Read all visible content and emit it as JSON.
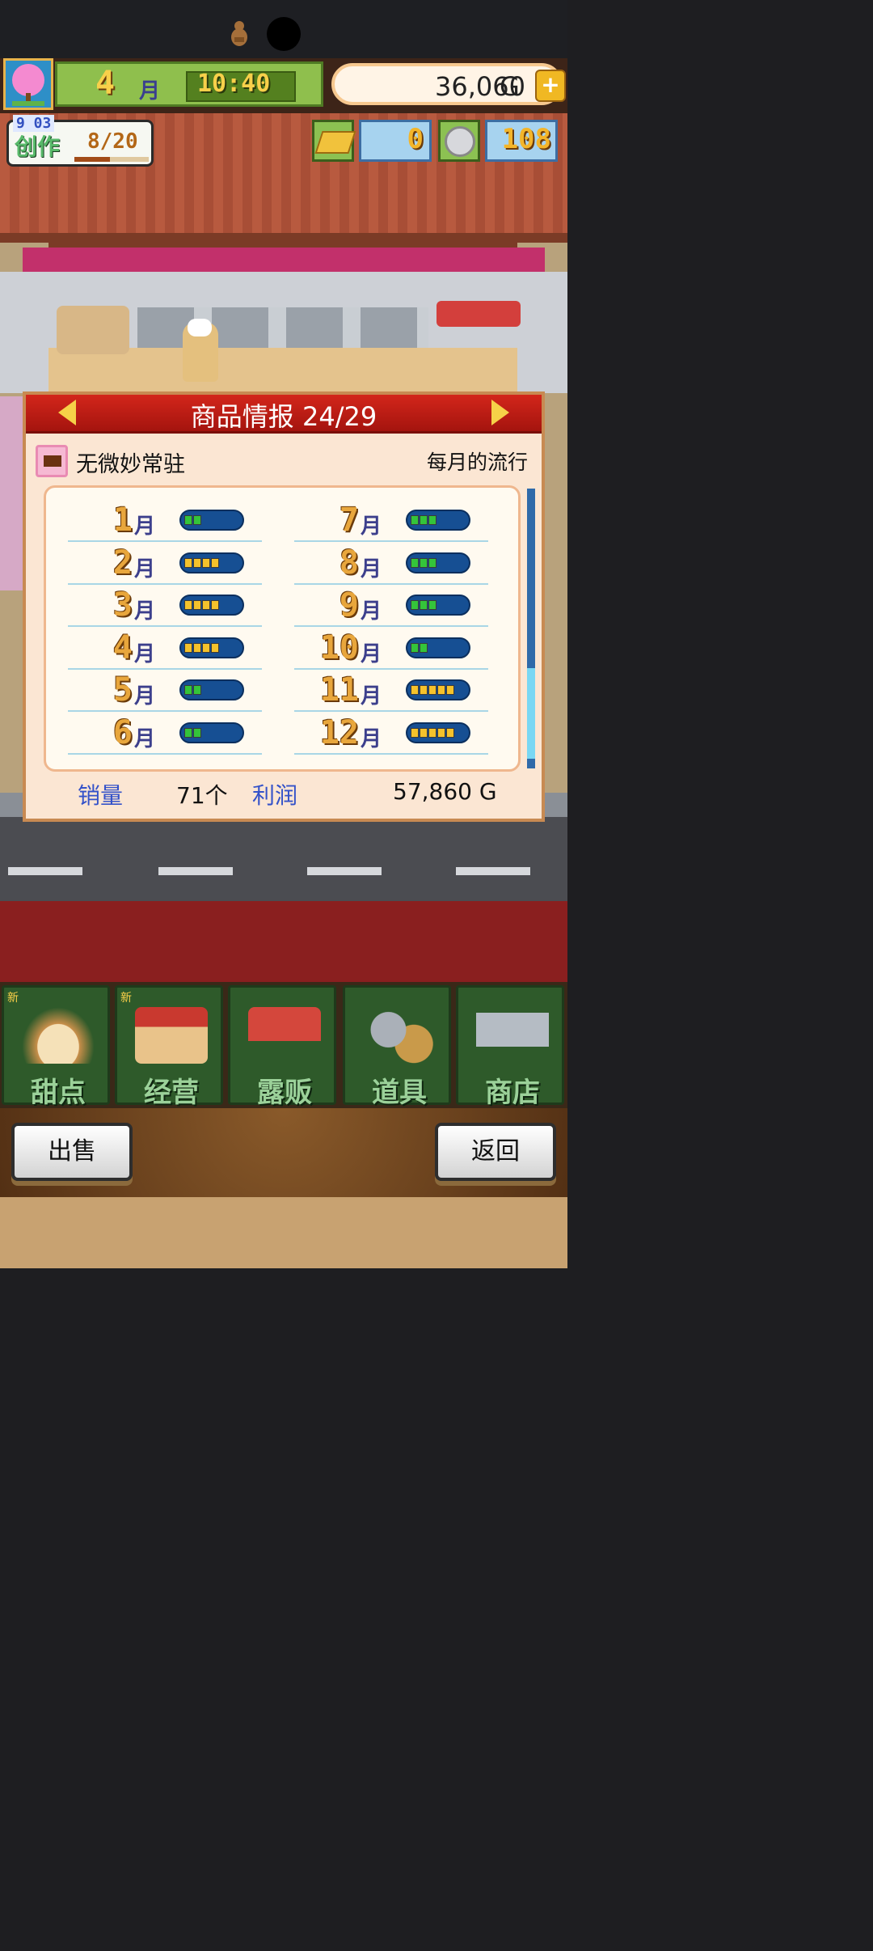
{
  "hud": {
    "month": "4",
    "month_unit": "月",
    "time": "10:40",
    "money": "36,060",
    "money_unit": "G",
    "money_add": "+",
    "create_label": "创作",
    "create_count": "8/20",
    "create_date": "9 03",
    "gold_bars": "0",
    "coins": "108"
  },
  "dialog": {
    "title": "商品情报 24/29",
    "product_name": "无微妙常驻",
    "trend_label": "每月的流行",
    "month_unit": "月",
    "months": [
      {
        "month": "1",
        "level": 2
      },
      {
        "month": "2",
        "level": 4
      },
      {
        "month": "3",
        "level": 4
      },
      {
        "month": "4",
        "level": 4
      },
      {
        "month": "5",
        "level": 2
      },
      {
        "month": "6",
        "level": 2
      },
      {
        "month": "7",
        "level": 3
      },
      {
        "month": "8",
        "level": 3
      },
      {
        "month": "9",
        "level": 3
      },
      {
        "month": "10",
        "level": 2
      },
      {
        "month": "11",
        "level": 5
      },
      {
        "month": "12",
        "level": 5
      }
    ],
    "sales_label": "销量",
    "sales_value": "71个",
    "profit_label": "利润",
    "profit_value": "57,860 G"
  },
  "menu": {
    "items": [
      {
        "label": "甜点",
        "new": "新"
      },
      {
        "label": "经营",
        "new": "新"
      },
      {
        "label": "露贩",
        "new": ""
      },
      {
        "label": "道具",
        "new": ""
      },
      {
        "label": "商店",
        "new": ""
      }
    ]
  },
  "footer": {
    "sell_label": "出售",
    "back_label": "返回"
  },
  "colors": {
    "bar_green": "#34c43a",
    "bar_yellow": "#f4c22c",
    "bar_bg": "#164f93"
  }
}
